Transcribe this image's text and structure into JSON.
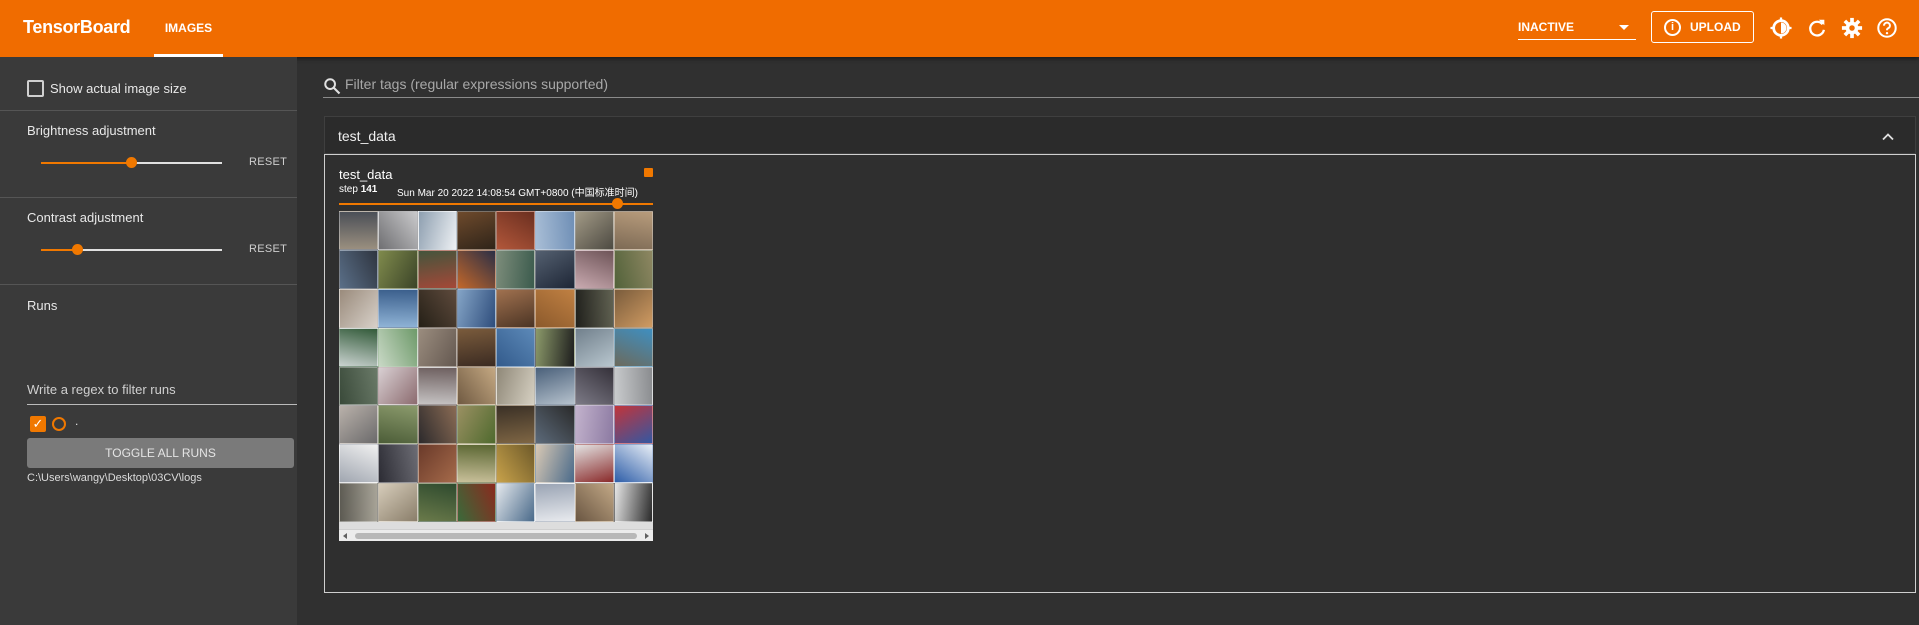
{
  "header": {
    "brand": "TensorBoard",
    "tab_label": "IMAGES",
    "status_select": "INACTIVE",
    "upload_label": "UPLOAD",
    "icons": [
      "info-icon",
      "brightness-icon",
      "refresh-icon",
      "settings-icon",
      "help-icon"
    ]
  },
  "sidebar": {
    "show_actual_size_label": "Show actual image size",
    "show_actual_size_checked": false,
    "brightness_label": "Brightness adjustment",
    "brightness_value": 0.5,
    "contrast_label": "Contrast adjustment",
    "contrast_value": 0.2,
    "reset_label": "RESET",
    "runs_label": "Runs",
    "runs_filter_placeholder": "Write a regex to filter runs",
    "run_name": ".",
    "run_checked": true,
    "toggle_all_label": "TOGGLE ALL RUNS",
    "log_dir": "C:\\Users\\wangy\\Desktop\\03CV\\logs"
  },
  "main": {
    "filter_placeholder": "Filter tags (regular expressions supported)",
    "card_title": "test_data",
    "image": {
      "tag": "test_data",
      "step_label": "step",
      "step": "141",
      "timestamp": "Sun Mar 20 2022 14:08:54 GMT+0800 (中国标准时间)",
      "step_slider_value": 1.0
    }
  },
  "colors": {
    "accent": "#f06c00",
    "background": "#303030",
    "sidebar": "#3a3a3a"
  }
}
